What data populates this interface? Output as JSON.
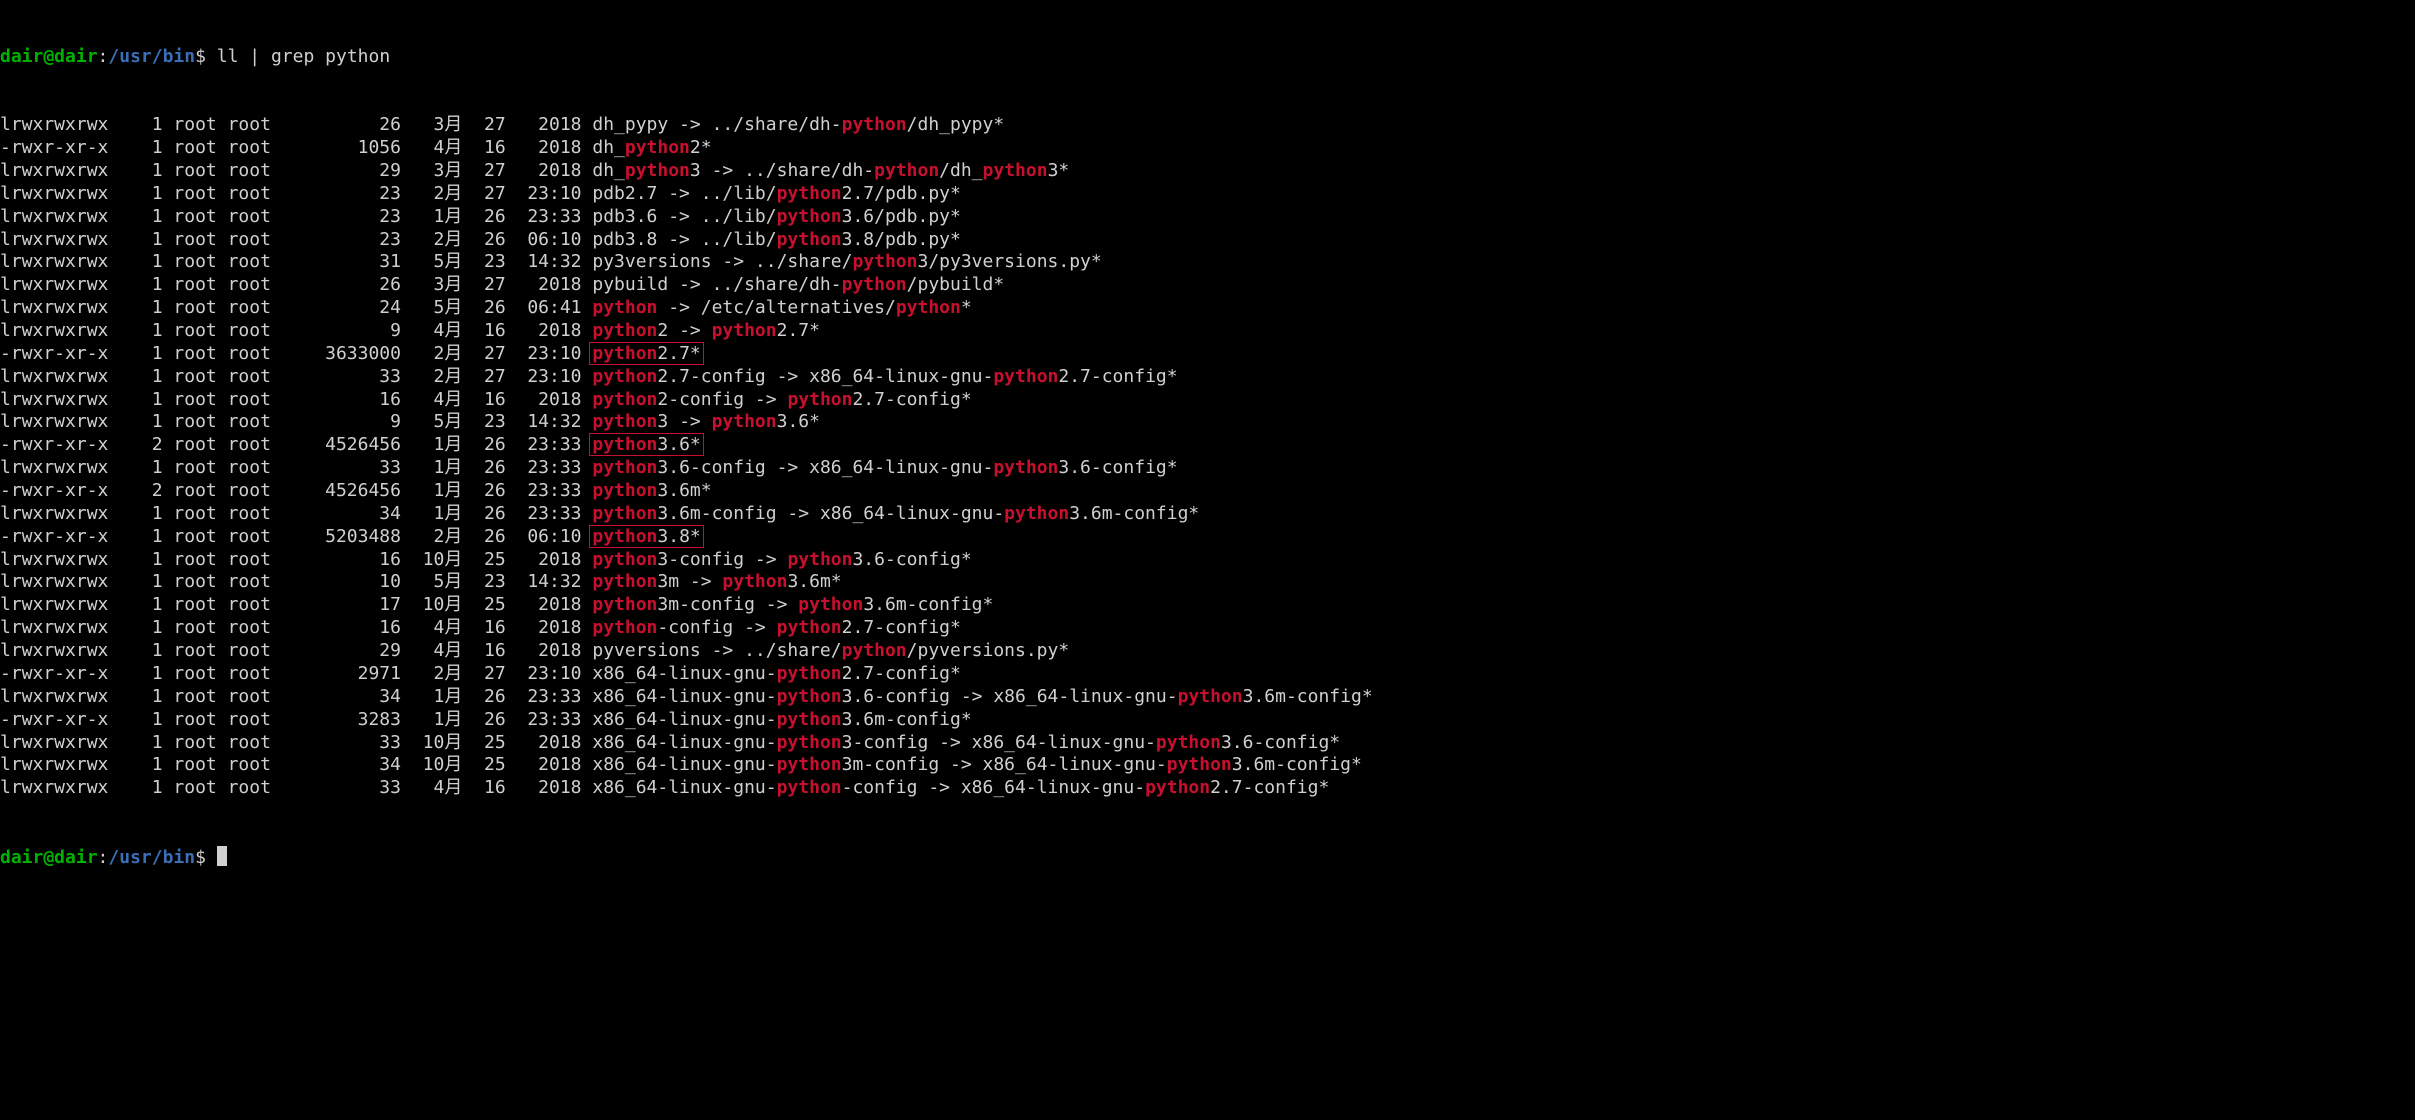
{
  "prompt": {
    "user": "dair@dair",
    "sep1": ":",
    "path": "/usr/bin",
    "dollar": "$ ",
    "command": "ll | grep python"
  },
  "cols": {
    "perm_w": 12,
    "links_w": 3,
    "owner": "root",
    "group": "root",
    "size_w": 11,
    "month_w": 5,
    "day_w": 4,
    "time_w": 6
  },
  "rows": [
    {
      "perm": "lrwxrwxrwx",
      "links": "1",
      "size": "26",
      "month": "3月",
      "day": "27",
      "time": "2018",
      "segs": [
        {
          "t": "dh_pypy -> ../share/dh-"
        },
        {
          "t": "python",
          "h": true
        },
        {
          "t": "/dh_pypy*"
        }
      ]
    },
    {
      "perm": "-rwxr-xr-x",
      "links": "1",
      "size": "1056",
      "month": "4月",
      "day": "16",
      "time": "2018",
      "segs": [
        {
          "t": "dh_"
        },
        {
          "t": "python",
          "h": true
        },
        {
          "t": "2*"
        }
      ]
    },
    {
      "perm": "lrwxrwxrwx",
      "links": "1",
      "size": "29",
      "month": "3月",
      "day": "27",
      "time": "2018",
      "segs": [
        {
          "t": "dh_"
        },
        {
          "t": "python",
          "h": true
        },
        {
          "t": "3 -> ../share/dh-"
        },
        {
          "t": "python",
          "h": true
        },
        {
          "t": "/dh_"
        },
        {
          "t": "python",
          "h": true
        },
        {
          "t": "3*"
        }
      ]
    },
    {
      "perm": "lrwxrwxrwx",
      "links": "1",
      "size": "23",
      "month": "2月",
      "day": "27",
      "time": "23:10",
      "segs": [
        {
          "t": "pdb2.7 -> ../lib/"
        },
        {
          "t": "python",
          "h": true
        },
        {
          "t": "2.7/pdb.py*"
        }
      ]
    },
    {
      "perm": "lrwxrwxrwx",
      "links": "1",
      "size": "23",
      "month": "1月",
      "day": "26",
      "time": "23:33",
      "segs": [
        {
          "t": "pdb3.6 -> ../lib/"
        },
        {
          "t": "python",
          "h": true
        },
        {
          "t": "3.6/pdb.py*"
        }
      ]
    },
    {
      "perm": "lrwxrwxrwx",
      "links": "1",
      "size": "23",
      "month": "2月",
      "day": "26",
      "time": "06:10",
      "segs": [
        {
          "t": "pdb3.8 -> ../lib/"
        },
        {
          "t": "python",
          "h": true
        },
        {
          "t": "3.8/pdb.py*"
        }
      ]
    },
    {
      "perm": "lrwxrwxrwx",
      "links": "1",
      "size": "31",
      "month": "5月",
      "day": "23",
      "time": "14:32",
      "segs": [
        {
          "t": "py3versions -> ../share/"
        },
        {
          "t": "python",
          "h": true
        },
        {
          "t": "3/py3versions.py*"
        }
      ]
    },
    {
      "perm": "lrwxrwxrwx",
      "links": "1",
      "size": "26",
      "month": "3月",
      "day": "27",
      "time": "2018",
      "segs": [
        {
          "t": "pybuild -> ../share/dh-"
        },
        {
          "t": "python",
          "h": true
        },
        {
          "t": "/pybuild*"
        }
      ]
    },
    {
      "perm": "lrwxrwxrwx",
      "links": "1",
      "size": "24",
      "month": "5月",
      "day": "26",
      "time": "06:41",
      "segs": [
        {
          "t": "python",
          "h": true
        },
        {
          "t": " -> /etc/alternatives/"
        },
        {
          "t": "python",
          "h": true
        },
        {
          "t": "*"
        }
      ]
    },
    {
      "perm": "lrwxrwxrwx",
      "links": "1",
      "size": "9",
      "month": "4月",
      "day": "16",
      "time": "2018",
      "segs": [
        {
          "t": "python",
          "h": true
        },
        {
          "t": "2 -> "
        },
        {
          "t": "python",
          "h": true
        },
        {
          "t": "2.7*"
        }
      ]
    },
    {
      "perm": "-rwxr-xr-x",
      "links": "1",
      "size": "3633000",
      "month": "2月",
      "day": "27",
      "time": "23:10",
      "boxed": true,
      "segs": [
        {
          "t": "python",
          "h": true
        },
        {
          "t": "2.7*"
        }
      ]
    },
    {
      "perm": "lrwxrwxrwx",
      "links": "1",
      "size": "33",
      "month": "2月",
      "day": "27",
      "time": "23:10",
      "segs": [
        {
          "t": "python",
          "h": true
        },
        {
          "t": "2.7-config -> x86_64-linux-gnu-"
        },
        {
          "t": "python",
          "h": true
        },
        {
          "t": "2.7-config*"
        }
      ]
    },
    {
      "perm": "lrwxrwxrwx",
      "links": "1",
      "size": "16",
      "month": "4月",
      "day": "16",
      "time": "2018",
      "segs": [
        {
          "t": "python",
          "h": true
        },
        {
          "t": "2-config -> "
        },
        {
          "t": "python",
          "h": true
        },
        {
          "t": "2.7-config*"
        }
      ]
    },
    {
      "perm": "lrwxrwxrwx",
      "links": "1",
      "size": "9",
      "month": "5月",
      "day": "23",
      "time": "14:32",
      "segs": [
        {
          "t": "python",
          "h": true
        },
        {
          "t": "3 -> "
        },
        {
          "t": "python",
          "h": true
        },
        {
          "t": "3.6*"
        }
      ]
    },
    {
      "perm": "-rwxr-xr-x",
      "links": "2",
      "size": "4526456",
      "month": "1月",
      "day": "26",
      "time": "23:33",
      "boxed": true,
      "segs": [
        {
          "t": "python",
          "h": true
        },
        {
          "t": "3.6*"
        }
      ]
    },
    {
      "perm": "lrwxrwxrwx",
      "links": "1",
      "size": "33",
      "month": "1月",
      "day": "26",
      "time": "23:33",
      "segs": [
        {
          "t": "python",
          "h": true
        },
        {
          "t": "3.6-config -> x86_64-linux-gnu-"
        },
        {
          "t": "python",
          "h": true
        },
        {
          "t": "3.6-config*"
        }
      ]
    },
    {
      "perm": "-rwxr-xr-x",
      "links": "2",
      "size": "4526456",
      "month": "1月",
      "day": "26",
      "time": "23:33",
      "segs": [
        {
          "t": "python",
          "h": true
        },
        {
          "t": "3.6m*"
        }
      ]
    },
    {
      "perm": "lrwxrwxrwx",
      "links": "1",
      "size": "34",
      "month": "1月",
      "day": "26",
      "time": "23:33",
      "segs": [
        {
          "t": "python",
          "h": true
        },
        {
          "t": "3.6m-config -> x86_64-linux-gnu-"
        },
        {
          "t": "python",
          "h": true
        },
        {
          "t": "3.6m-config*"
        }
      ]
    },
    {
      "perm": "-rwxr-xr-x",
      "links": "1",
      "size": "5203488",
      "month": "2月",
      "day": "26",
      "time": "06:10",
      "boxed": true,
      "segs": [
        {
          "t": "python",
          "h": true
        },
        {
          "t": "3.8*"
        }
      ]
    },
    {
      "perm": "lrwxrwxrwx",
      "links": "1",
      "size": "16",
      "month": "10月",
      "day": "25",
      "time": "2018",
      "segs": [
        {
          "t": "python",
          "h": true
        },
        {
          "t": "3-config -> "
        },
        {
          "t": "python",
          "h": true
        },
        {
          "t": "3.6-config*"
        }
      ]
    },
    {
      "perm": "lrwxrwxrwx",
      "links": "1",
      "size": "10",
      "month": "5月",
      "day": "23",
      "time": "14:32",
      "segs": [
        {
          "t": "python",
          "h": true
        },
        {
          "t": "3m -> "
        },
        {
          "t": "python",
          "h": true
        },
        {
          "t": "3.6m*"
        }
      ]
    },
    {
      "perm": "lrwxrwxrwx",
      "links": "1",
      "size": "17",
      "month": "10月",
      "day": "25",
      "time": "2018",
      "segs": [
        {
          "t": "python",
          "h": true
        },
        {
          "t": "3m-config -> "
        },
        {
          "t": "python",
          "h": true
        },
        {
          "t": "3.6m-config*"
        }
      ]
    },
    {
      "perm": "lrwxrwxrwx",
      "links": "1",
      "size": "16",
      "month": "4月",
      "day": "16",
      "time": "2018",
      "segs": [
        {
          "t": "python",
          "h": true
        },
        {
          "t": "-config -> "
        },
        {
          "t": "python",
          "h": true
        },
        {
          "t": "2.7-config*"
        }
      ]
    },
    {
      "perm": "lrwxrwxrwx",
      "links": "1",
      "size": "29",
      "month": "4月",
      "day": "16",
      "time": "2018",
      "segs": [
        {
          "t": "pyversions -> ../share/"
        },
        {
          "t": "python",
          "h": true
        },
        {
          "t": "/pyversions.py*"
        }
      ]
    },
    {
      "perm": "-rwxr-xr-x",
      "links": "1",
      "size": "2971",
      "month": "2月",
      "day": "27",
      "time": "23:10",
      "segs": [
        {
          "t": "x86_64-linux-gnu-"
        },
        {
          "t": "python",
          "h": true
        },
        {
          "t": "2.7-config*"
        }
      ]
    },
    {
      "perm": "lrwxrwxrwx",
      "links": "1",
      "size": "34",
      "month": "1月",
      "day": "26",
      "time": "23:33",
      "segs": [
        {
          "t": "x86_64-linux-gnu-"
        },
        {
          "t": "python",
          "h": true
        },
        {
          "t": "3.6-config -> x86_64-linux-gnu-"
        },
        {
          "t": "python",
          "h": true
        },
        {
          "t": "3.6m-config*"
        }
      ]
    },
    {
      "perm": "-rwxr-xr-x",
      "links": "1",
      "size": "3283",
      "month": "1月",
      "day": "26",
      "time": "23:33",
      "segs": [
        {
          "t": "x86_64-linux-gnu-"
        },
        {
          "t": "python",
          "h": true
        },
        {
          "t": "3.6m-config*"
        }
      ]
    },
    {
      "perm": "lrwxrwxrwx",
      "links": "1",
      "size": "33",
      "month": "10月",
      "day": "25",
      "time": "2018",
      "segs": [
        {
          "t": "x86_64-linux-gnu-"
        },
        {
          "t": "python",
          "h": true
        },
        {
          "t": "3-config -> x86_64-linux-gnu-"
        },
        {
          "t": "python",
          "h": true
        },
        {
          "t": "3.6-config*"
        }
      ]
    },
    {
      "perm": "lrwxrwxrwx",
      "links": "1",
      "size": "34",
      "month": "10月",
      "day": "25",
      "time": "2018",
      "segs": [
        {
          "t": "x86_64-linux-gnu-"
        },
        {
          "t": "python",
          "h": true
        },
        {
          "t": "3m-config -> x86_64-linux-gnu-"
        },
        {
          "t": "python",
          "h": true
        },
        {
          "t": "3.6m-config*"
        }
      ]
    },
    {
      "perm": "lrwxrwxrwx",
      "links": "1",
      "size": "33",
      "month": "4月",
      "day": "16",
      "time": "2018",
      "segs": [
        {
          "t": "x86_64-linux-gnu-"
        },
        {
          "t": "python",
          "h": true
        },
        {
          "t": "-config -> x86_64-linux-gnu-"
        },
        {
          "t": "python",
          "h": true
        },
        {
          "t": "2.7-config*"
        }
      ]
    }
  ]
}
